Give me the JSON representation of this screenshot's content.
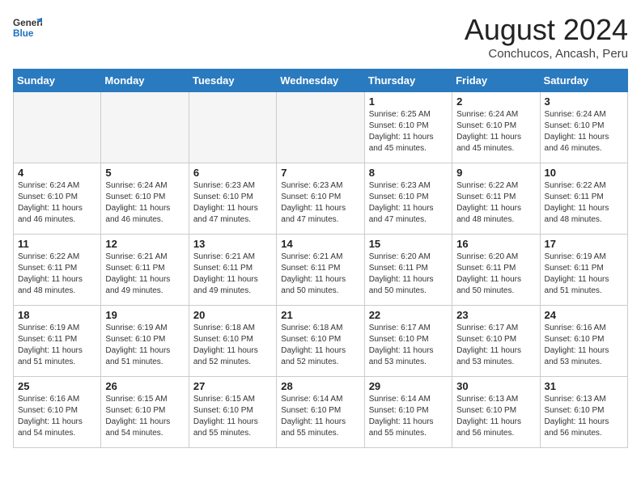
{
  "header": {
    "logo_general": "General",
    "logo_blue": "Blue",
    "title": "August 2024",
    "subtitle": "Conchucos, Ancash, Peru"
  },
  "days_of_week": [
    "Sunday",
    "Monday",
    "Tuesday",
    "Wednesday",
    "Thursday",
    "Friday",
    "Saturday"
  ],
  "weeks": [
    [
      {
        "num": "",
        "info": ""
      },
      {
        "num": "",
        "info": ""
      },
      {
        "num": "",
        "info": ""
      },
      {
        "num": "",
        "info": ""
      },
      {
        "num": "1",
        "info": "Sunrise: 6:25 AM\nSunset: 6:10 PM\nDaylight: 11 hours\nand 45 minutes."
      },
      {
        "num": "2",
        "info": "Sunrise: 6:24 AM\nSunset: 6:10 PM\nDaylight: 11 hours\nand 45 minutes."
      },
      {
        "num": "3",
        "info": "Sunrise: 6:24 AM\nSunset: 6:10 PM\nDaylight: 11 hours\nand 46 minutes."
      }
    ],
    [
      {
        "num": "4",
        "info": "Sunrise: 6:24 AM\nSunset: 6:10 PM\nDaylight: 11 hours\nand 46 minutes."
      },
      {
        "num": "5",
        "info": "Sunrise: 6:24 AM\nSunset: 6:10 PM\nDaylight: 11 hours\nand 46 minutes."
      },
      {
        "num": "6",
        "info": "Sunrise: 6:23 AM\nSunset: 6:10 PM\nDaylight: 11 hours\nand 47 minutes."
      },
      {
        "num": "7",
        "info": "Sunrise: 6:23 AM\nSunset: 6:10 PM\nDaylight: 11 hours\nand 47 minutes."
      },
      {
        "num": "8",
        "info": "Sunrise: 6:23 AM\nSunset: 6:10 PM\nDaylight: 11 hours\nand 47 minutes."
      },
      {
        "num": "9",
        "info": "Sunrise: 6:22 AM\nSunset: 6:11 PM\nDaylight: 11 hours\nand 48 minutes."
      },
      {
        "num": "10",
        "info": "Sunrise: 6:22 AM\nSunset: 6:11 PM\nDaylight: 11 hours\nand 48 minutes."
      }
    ],
    [
      {
        "num": "11",
        "info": "Sunrise: 6:22 AM\nSunset: 6:11 PM\nDaylight: 11 hours\nand 48 minutes."
      },
      {
        "num": "12",
        "info": "Sunrise: 6:21 AM\nSunset: 6:11 PM\nDaylight: 11 hours\nand 49 minutes."
      },
      {
        "num": "13",
        "info": "Sunrise: 6:21 AM\nSunset: 6:11 PM\nDaylight: 11 hours\nand 49 minutes."
      },
      {
        "num": "14",
        "info": "Sunrise: 6:21 AM\nSunset: 6:11 PM\nDaylight: 11 hours\nand 50 minutes."
      },
      {
        "num": "15",
        "info": "Sunrise: 6:20 AM\nSunset: 6:11 PM\nDaylight: 11 hours\nand 50 minutes."
      },
      {
        "num": "16",
        "info": "Sunrise: 6:20 AM\nSunset: 6:11 PM\nDaylight: 11 hours\nand 50 minutes."
      },
      {
        "num": "17",
        "info": "Sunrise: 6:19 AM\nSunset: 6:11 PM\nDaylight: 11 hours\nand 51 minutes."
      }
    ],
    [
      {
        "num": "18",
        "info": "Sunrise: 6:19 AM\nSunset: 6:11 PM\nDaylight: 11 hours\nand 51 minutes."
      },
      {
        "num": "19",
        "info": "Sunrise: 6:19 AM\nSunset: 6:10 PM\nDaylight: 11 hours\nand 51 minutes."
      },
      {
        "num": "20",
        "info": "Sunrise: 6:18 AM\nSunset: 6:10 PM\nDaylight: 11 hours\nand 52 minutes."
      },
      {
        "num": "21",
        "info": "Sunrise: 6:18 AM\nSunset: 6:10 PM\nDaylight: 11 hours\nand 52 minutes."
      },
      {
        "num": "22",
        "info": "Sunrise: 6:17 AM\nSunset: 6:10 PM\nDaylight: 11 hours\nand 53 minutes."
      },
      {
        "num": "23",
        "info": "Sunrise: 6:17 AM\nSunset: 6:10 PM\nDaylight: 11 hours\nand 53 minutes."
      },
      {
        "num": "24",
        "info": "Sunrise: 6:16 AM\nSunset: 6:10 PM\nDaylight: 11 hours\nand 53 minutes."
      }
    ],
    [
      {
        "num": "25",
        "info": "Sunrise: 6:16 AM\nSunset: 6:10 PM\nDaylight: 11 hours\nand 54 minutes."
      },
      {
        "num": "26",
        "info": "Sunrise: 6:15 AM\nSunset: 6:10 PM\nDaylight: 11 hours\nand 54 minutes."
      },
      {
        "num": "27",
        "info": "Sunrise: 6:15 AM\nSunset: 6:10 PM\nDaylight: 11 hours\nand 55 minutes."
      },
      {
        "num": "28",
        "info": "Sunrise: 6:14 AM\nSunset: 6:10 PM\nDaylight: 11 hours\nand 55 minutes."
      },
      {
        "num": "29",
        "info": "Sunrise: 6:14 AM\nSunset: 6:10 PM\nDaylight: 11 hours\nand 55 minutes."
      },
      {
        "num": "30",
        "info": "Sunrise: 6:13 AM\nSunset: 6:10 PM\nDaylight: 11 hours\nand 56 minutes."
      },
      {
        "num": "31",
        "info": "Sunrise: 6:13 AM\nSunset: 6:10 PM\nDaylight: 11 hours\nand 56 minutes."
      }
    ]
  ]
}
